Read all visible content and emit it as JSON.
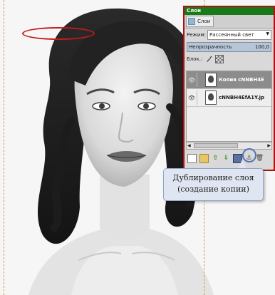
{
  "panel": {
    "title": "Слои",
    "tab_label": "Слои",
    "mode_label": "Режим:",
    "mode_value": "Рассеянный свет",
    "opacity_label": "Непрозрачность",
    "opacity_value": "100,0",
    "lock_label": "Блок.:"
  },
  "layers": [
    {
      "name": "Копия cNNBH4E",
      "selected": true
    },
    {
      "name": "cNNBH4EfA1Y.jp",
      "selected": false
    }
  ],
  "toolbar_icons": [
    "new-layer-icon",
    "folder-icon",
    "raise-layer-icon",
    "lower-layer-icon",
    "duplicate-layer-icon",
    "anchor-icon",
    "delete-layer-icon"
  ],
  "callout": {
    "line1": "Дублирование слоя",
    "line2": "(создание копии)"
  },
  "colors": {
    "panel_title_bg": "#1a7a1a",
    "highlight_ring": "#c41a1a",
    "callout_bg": "#dfe6f2",
    "callout_ring": "#5472b5",
    "selected_layer_bg": "#8c8c8c"
  }
}
